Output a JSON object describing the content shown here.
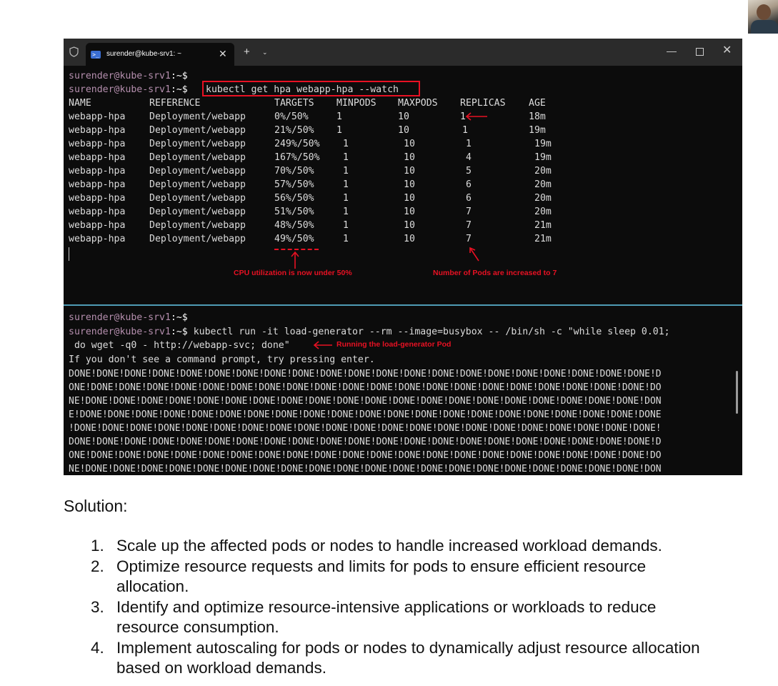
{
  "terminal": {
    "tab_title": "surender@kube-srv1: ~",
    "prompt_user": "surender@kube-srv1",
    "prompt_sep": ":~$",
    "top_pane": {
      "command": "kubectl get hpa webapp-hpa --watch",
      "columns": [
        "NAME",
        "REFERENCE",
        "TARGETS",
        "MINPODS",
        "MAXPODS",
        "REPLICAS",
        "AGE"
      ],
      "rows": [
        [
          "webapp-hpa",
          "Deployment/webapp",
          "0%/50%",
          "1",
          "10",
          "1",
          "18m"
        ],
        [
          "webapp-hpa",
          "Deployment/webapp",
          "21%/50%",
          "1",
          "10",
          "1",
          "19m"
        ],
        [
          "webapp-hpa",
          "Deployment/webapp",
          "249%/50%",
          "1",
          "10",
          "1",
          "19m"
        ],
        [
          "webapp-hpa",
          "Deployment/webapp",
          "167%/50%",
          "1",
          "10",
          "4",
          "19m"
        ],
        [
          "webapp-hpa",
          "Deployment/webapp",
          "70%/50%",
          "1",
          "10",
          "5",
          "20m"
        ],
        [
          "webapp-hpa",
          "Deployment/webapp",
          "57%/50%",
          "1",
          "10",
          "6",
          "20m"
        ],
        [
          "webapp-hpa",
          "Deployment/webapp",
          "56%/50%",
          "1",
          "10",
          "6",
          "20m"
        ],
        [
          "webapp-hpa",
          "Deployment/webapp",
          "51%/50%",
          "1",
          "10",
          "7",
          "20m"
        ],
        [
          "webapp-hpa",
          "Deployment/webapp",
          "48%/50%",
          "1",
          "10",
          "7",
          "21m"
        ],
        [
          "webapp-hpa",
          "Deployment/webapp",
          "49%/50%",
          "1",
          "10",
          "7",
          "21m"
        ]
      ],
      "annotation_cpu": "CPU utilization  is now under 50%",
      "annotation_pods": "Number of Pods are increased to 7"
    },
    "bottom_pane": {
      "command_line1": "kubectl run -it load-generator --rm --image=busybox -- /bin/sh -c \"while sleep 0.01;",
      "command_line2": " do wget -q0 - http://webapp-svc; done\"",
      "annotation_load": "Running the load-generator Pod",
      "hint": "If you don't see a command prompt, try pressing enter.",
      "output_lines": [
        "DONE!DONE!DONE!DONE!DONE!DONE!DONE!DONE!DONE!DONE!DONE!DONE!DONE!DONE!DONE!DONE!DONE!DONE!DONE!DONE!DONE!D",
        "ONE!DONE!DONE!DONE!DONE!DONE!DONE!DONE!DONE!DONE!DONE!DONE!DONE!DONE!DONE!DONE!DONE!DONE!DONE!DONE!DONE!DO",
        "NE!DONE!DONE!DONE!DONE!DONE!DONE!DONE!DONE!DONE!DONE!DONE!DONE!DONE!DONE!DONE!DONE!DONE!DONE!DONE!DONE!DON",
        "E!DONE!DONE!DONE!DONE!DONE!DONE!DONE!DONE!DONE!DONE!DONE!DONE!DONE!DONE!DONE!DONE!DONE!DONE!DONE!DONE!DONE",
        "!DONE!DONE!DONE!DONE!DONE!DONE!DONE!DONE!DONE!DONE!DONE!DONE!DONE!DONE!DONE!DONE!DONE!DONE!DONE!DONE!DONE!",
        "DONE!DONE!DONE!DONE!DONE!DONE!DONE!DONE!DONE!DONE!DONE!DONE!DONE!DONE!DONE!DONE!DONE!DONE!DONE!DONE!DONE!D",
        "ONE!DONE!DONE!DONE!DONE!DONE!DONE!DONE!DONE!DONE!DONE!DONE!DONE!DONE!DONE!DONE!DONE!DONE!DONE!DONE!DONE!DO",
        "NE!DONE!DONE!DONE!DONE!DONE!DONE!DONE!DONE!DONE!DONE!DONE!DONE!DONE!DONE!DONE!DONE!DONE!DONE!DONE!DONE!DON"
      ]
    }
  },
  "document": {
    "solution_heading": "Solution:",
    "steps": [
      {
        "num": "1.",
        "text": "Scale up the affected pods or nodes to handle increased workload demands."
      },
      {
        "num": "2.",
        "text": "Optimize resource requests and limits for pods to ensure efficient resource allocation."
      },
      {
        "num": "3.",
        "text": "Identify and optimize resource-intensive applications or workloads to reduce resource consumption."
      },
      {
        "num": "4.",
        "text": "Implement autoscaling for pods or nodes to dynamically adjust resource allocation based on workload demands."
      }
    ]
  },
  "colors": {
    "terminal_bg": "#0c0c0c",
    "titlebar_bg": "#2b2b2b",
    "prompt_user": "#b48ead",
    "annotation_red": "#e81123",
    "pane_divider": "#4f9bb5"
  }
}
